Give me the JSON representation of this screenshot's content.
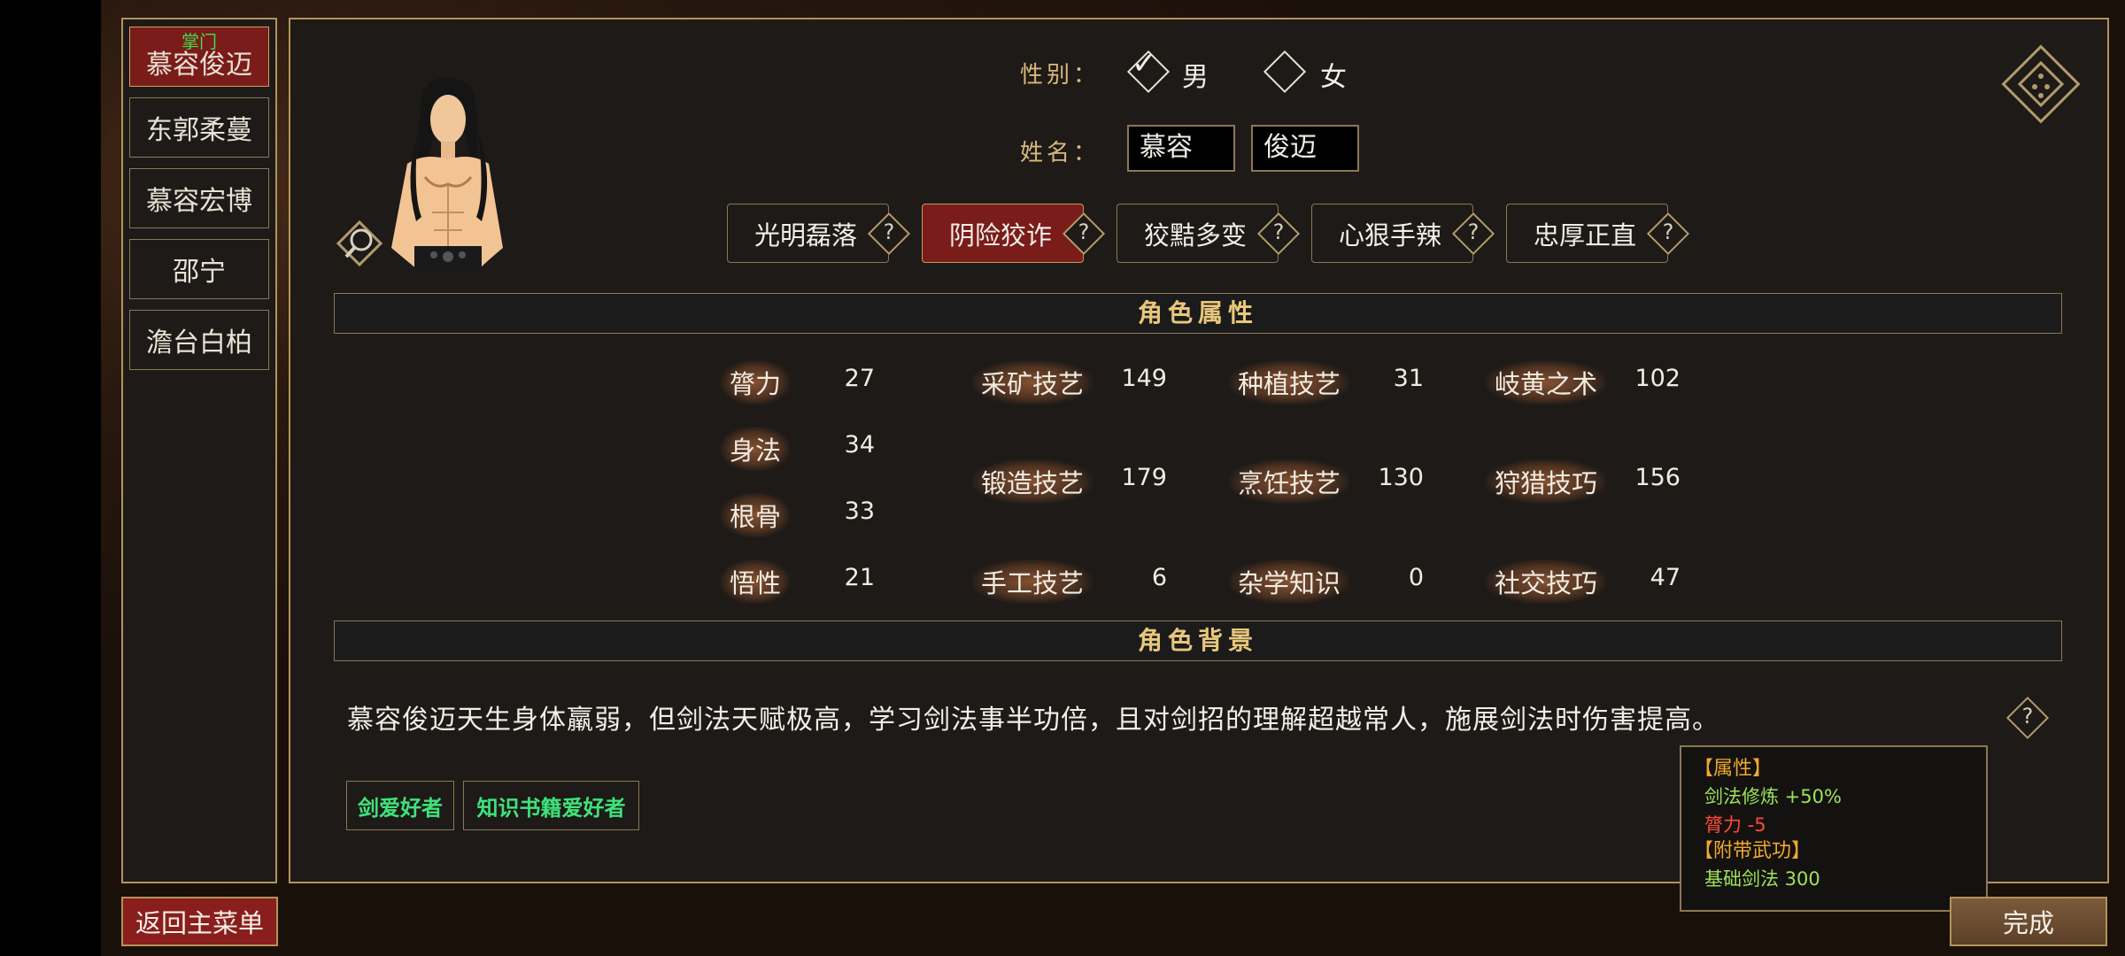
{
  "members": [
    {
      "badge": "掌门",
      "name": "慕容俊迈"
    },
    {
      "name": "东郭柔蔓"
    },
    {
      "name": "慕容宏博"
    },
    {
      "name": "邵宁"
    },
    {
      "name": "澹台白柏"
    }
  ],
  "gender": {
    "label": "性别：",
    "male": "男",
    "female": "女",
    "selected": "male"
  },
  "name": {
    "label": "姓名：",
    "surname": "慕容",
    "given": "俊迈"
  },
  "traits": [
    {
      "label": "光明磊落"
    },
    {
      "label": "阴险狡诈",
      "active": true
    },
    {
      "label": "狡黠多变"
    },
    {
      "label": "心狠手辣"
    },
    {
      "label": "忠厚正直"
    }
  ],
  "help_symbol": "?",
  "sections": {
    "attributes": "角色属性",
    "background": "角色背景"
  },
  "base_stats": [
    {
      "label": "膂力",
      "value": "27"
    },
    {
      "label": "身法",
      "value": "34"
    },
    {
      "label": "根骨",
      "value": "33"
    },
    {
      "label": "悟性",
      "value": "21"
    }
  ],
  "skills": {
    "col1": [
      {
        "label": "采矿技艺",
        "value": "149"
      },
      {
        "label": "锻造技艺",
        "value": "179"
      },
      {
        "label": "手工技艺",
        "value": "6"
      }
    ],
    "col2": [
      {
        "label": "种植技艺",
        "value": "31"
      },
      {
        "label": "烹饪技艺",
        "value": "130"
      },
      {
        "label": "杂学知识",
        "value": "0"
      }
    ],
    "col3": [
      {
        "label": "岐黄之术",
        "value": "102"
      },
      {
        "label": "狩猎技巧",
        "value": "156"
      },
      {
        "label": "社交技巧",
        "value": "47"
      }
    ]
  },
  "bio": "慕容俊迈天生身体羸弱，但剑法天赋极高，学习剑法事半功倍，且对剑招的理解超越常人，施展剑法时伤害提高。",
  "tags": [
    "剑爱好者",
    "知识书籍爱好者"
  ],
  "tooltip": {
    "attr_header": "【属性】",
    "bonus_pos": "剑法修炼  +50%",
    "bonus_neg": "膂力  -5",
    "martial_header": "【附带武功】",
    "martial": "基础剑法  300"
  },
  "buttons": {
    "back": "返回主菜单",
    "done": "完成"
  },
  "colors": {
    "accent_red": "#7a1c1a",
    "border_gold": "#b3925c",
    "title_gold": "#e8c77b"
  },
  "icons": [
    "dice-icon",
    "magnifier-icon",
    "help-icon",
    "checkmark-icon"
  ]
}
